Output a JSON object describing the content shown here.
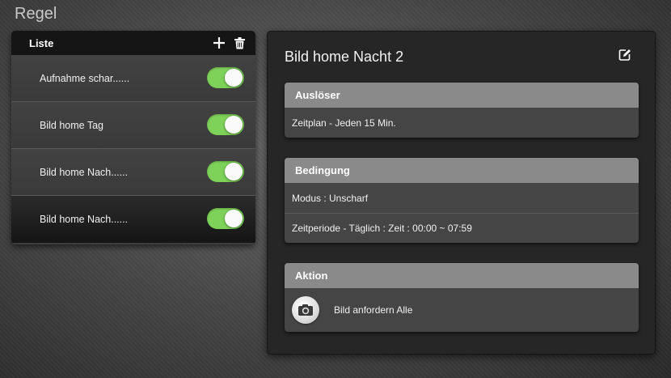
{
  "page": {
    "title": "Regel"
  },
  "list": {
    "title": "Liste",
    "add_icon": "plus-icon",
    "delete_icon": "trash-icon",
    "items": [
      {
        "label": "Aufnahme schar......",
        "enabled": true,
        "selected": false
      },
      {
        "label": "Bild home Tag",
        "enabled": true,
        "selected": false
      },
      {
        "label": "Bild home Nach......",
        "enabled": true,
        "selected": false
      },
      {
        "label": "Bild home Nach......",
        "enabled": true,
        "selected": true
      }
    ]
  },
  "detail": {
    "title": "Bild home Nacht 2",
    "edit_icon": "edit-icon",
    "trigger": {
      "header": "Auslöser",
      "rows": [
        "Zeitplan - Jeden 15 Min."
      ]
    },
    "condition": {
      "header": "Bedingung",
      "rows": [
        "Modus : Unscharf",
        "Zeitperiode - Täglich : Zeit : 00:00 ~ 07:59"
      ]
    },
    "action": {
      "header": "Aktion",
      "icon": "camera-icon",
      "label": "Bild anfordern Alle"
    }
  },
  "colors": {
    "toggle_on": "#7ed25a",
    "section_header": "#8a8a8a",
    "list_header": "#151515"
  }
}
